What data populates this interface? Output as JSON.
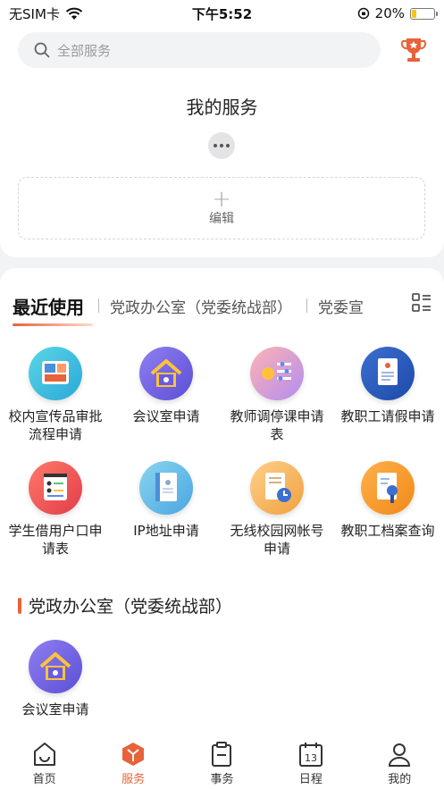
{
  "status_bar": {
    "carrier": "无SIM卡",
    "time": "下午5:52",
    "battery": "20%",
    "battery_level": 0.2
  },
  "search": {
    "placeholder": "全部服务"
  },
  "my_services": {
    "title": "我的服务",
    "edit_label": "编辑"
  },
  "tabs": [
    {
      "label": "最近使用"
    },
    {
      "label": "党政办公室（党委统战部）"
    },
    {
      "label": "党委宣"
    }
  ],
  "recent_services": [
    {
      "label": "校内宣传品审批流程申请",
      "icon": "layout-board-icon"
    },
    {
      "label": "会议室申请",
      "icon": "house-icon"
    },
    {
      "label": "教师调停课申请表",
      "icon": "schedule-sliders-icon"
    },
    {
      "label": "教职工请假申请",
      "icon": "document-icon"
    },
    {
      "label": "学生借用户口申请表",
      "icon": "contact-list-icon"
    },
    {
      "label": "IP地址申请",
      "icon": "id-card-icon"
    },
    {
      "label": "无线校园网帐号申请",
      "icon": "clock-document-icon"
    },
    {
      "label": "教职工档案查询",
      "icon": "file-search-icon"
    }
  ],
  "section": {
    "title": "党政办公室（党委统战部）",
    "services": [
      {
        "label": "会议室申请",
        "icon": "house-icon"
      }
    ]
  },
  "bottom_nav": [
    {
      "label": "首页",
      "icon": "home-icon"
    },
    {
      "label": "服务",
      "icon": "service-cube-icon",
      "active": true
    },
    {
      "label": "事务",
      "icon": "clipboard-icon"
    },
    {
      "label": "日程",
      "icon": "calendar-icon"
    },
    {
      "label": "我的",
      "icon": "profile-icon"
    }
  ],
  "colors": {
    "accent": "#e8623a",
    "background": "#f2f3f5"
  }
}
